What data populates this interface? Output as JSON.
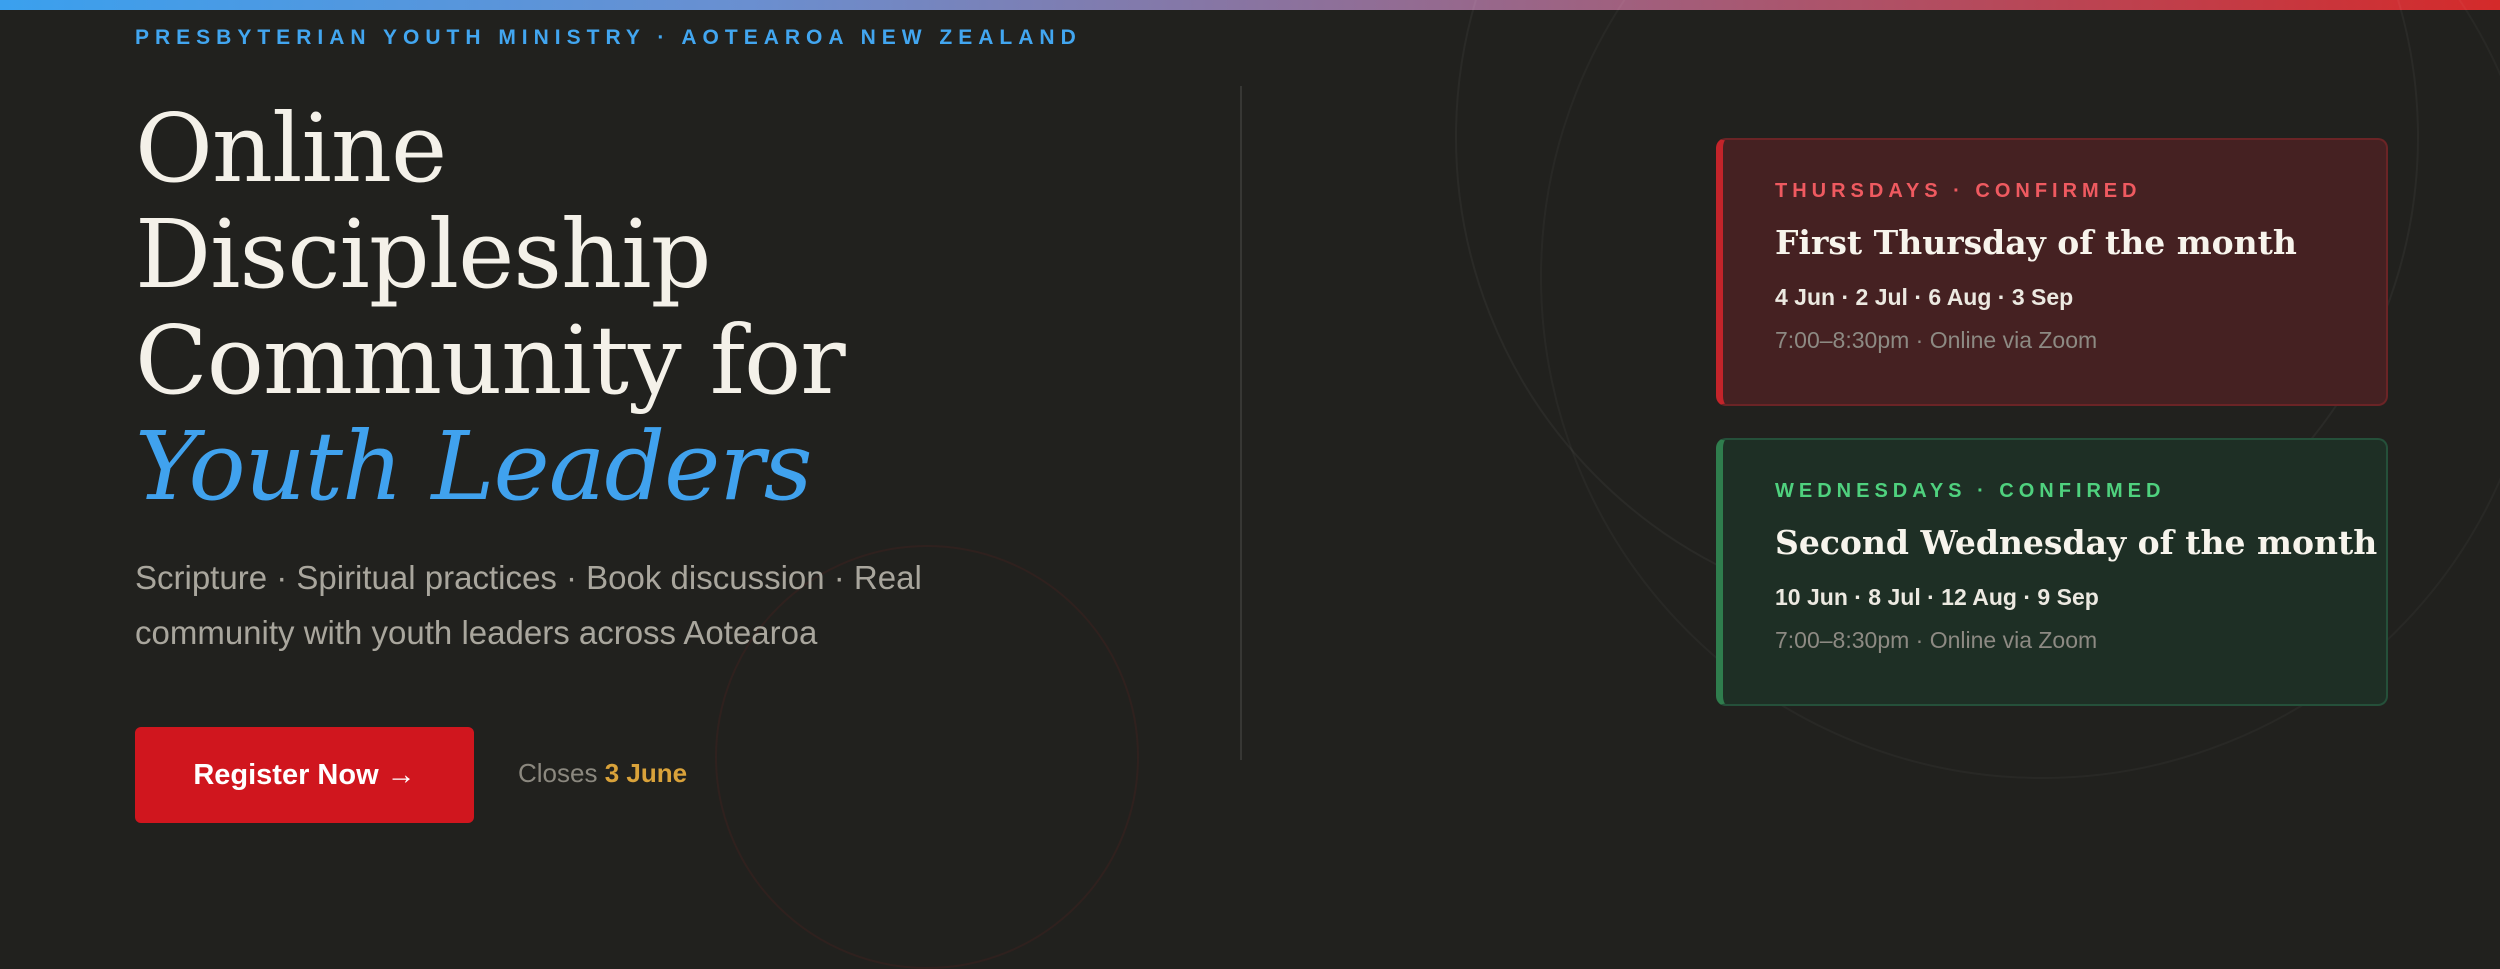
{
  "colors": {
    "background": "#21211e",
    "accent_blue": "#40a2ee",
    "accent_red": "#d0161e",
    "deadline_gold": "#d9a23a",
    "thursday_accent": "#ef5a60",
    "wednesday_accent": "#4fd17e"
  },
  "header": {
    "eyebrow": "PRESBYTERIAN YOUTH MINISTRY · AOTEAROA NEW ZEALAND"
  },
  "hero": {
    "title_lines": [
      "Online",
      "Discipleship",
      "Community for"
    ],
    "title_accent": "Youth Leaders",
    "subtitle": "Scripture · Spiritual practices · Book discussion · Real community with youth leaders across Aotearoa"
  },
  "cta": {
    "register_label": "Register Now",
    "register_arrow": "→",
    "register_icon": "arrow-right-icon",
    "closes_prefix": "Closes",
    "closes_date": "3 June"
  },
  "sessions": [
    {
      "label": "THURSDAYS · CONFIRMED",
      "title": "First Thursday of the month",
      "dates": "4 Jun · 2 Jul · 6 Aug · 3 Sep",
      "time": "7:00–8:30pm · Online via Zoom"
    },
    {
      "label": "WEDNESDAYS · CONFIRMED",
      "title": "Second Wednesday of the month",
      "dates": "10 Jun · 8 Jul · 12 Aug · 9 Sep",
      "time": "7:00–8:30pm · Online via Zoom"
    }
  ]
}
